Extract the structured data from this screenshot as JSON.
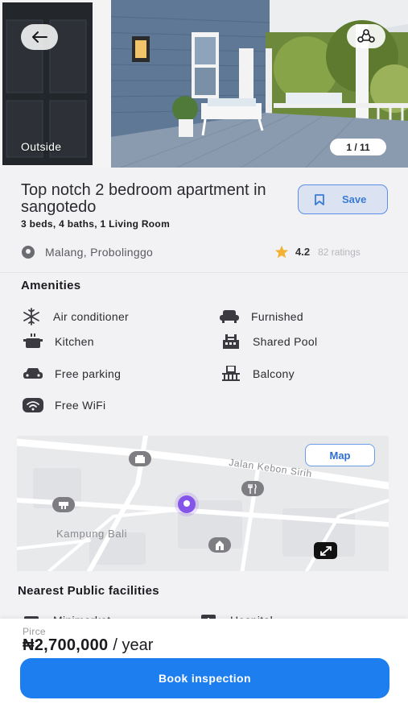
{
  "hero": {
    "caption": "Outside",
    "photo_counter": "1 / 11",
    "back_icon": "arrow-left-icon",
    "share_icon": "share-icon"
  },
  "listing": {
    "title": "Top notch 2 bedroom apartment in sangotedo",
    "subtitle": "3 beds, 4 baths, 1 Living Room",
    "save_label": "Save",
    "location": "Malang, Probolinggo",
    "rating": "4.2",
    "rating_count": "82 ratings"
  },
  "amenities": {
    "title": "Amenities",
    "items": [
      {
        "label": "Air conditioner",
        "icon": "snowflake-icon"
      },
      {
        "label": "Furnished",
        "icon": "sofa-icon"
      },
      {
        "label": "Kitchen",
        "icon": "pot-icon"
      },
      {
        "label": "Shared Pool",
        "icon": "pool-icon"
      },
      {
        "label": "Free parking",
        "icon": "car-icon"
      },
      {
        "label": "Balcony",
        "icon": "balcony-icon"
      },
      {
        "label": "Free WiFi",
        "icon": "wifi-icon"
      }
    ]
  },
  "map": {
    "button_label": "Map",
    "street_label": "Jalan Kebon Sirih",
    "area_label": "Kampung Bali"
  },
  "facilities": {
    "title": "Nearest Public facilities",
    "items": [
      {
        "label": "Minimarket",
        "icon": "store-icon"
      },
      {
        "label": "Hospital",
        "icon": "hospital-icon"
      }
    ]
  },
  "booking": {
    "price_label": "Pirce",
    "price": "₦2,700,000",
    "period": "/ year",
    "button_label": "Book inspection"
  },
  "colors": {
    "primary": "#1d7ef0",
    "save_accent": "#3a7bd5",
    "star": "#f2b233",
    "location_dot": "#8455e8"
  }
}
